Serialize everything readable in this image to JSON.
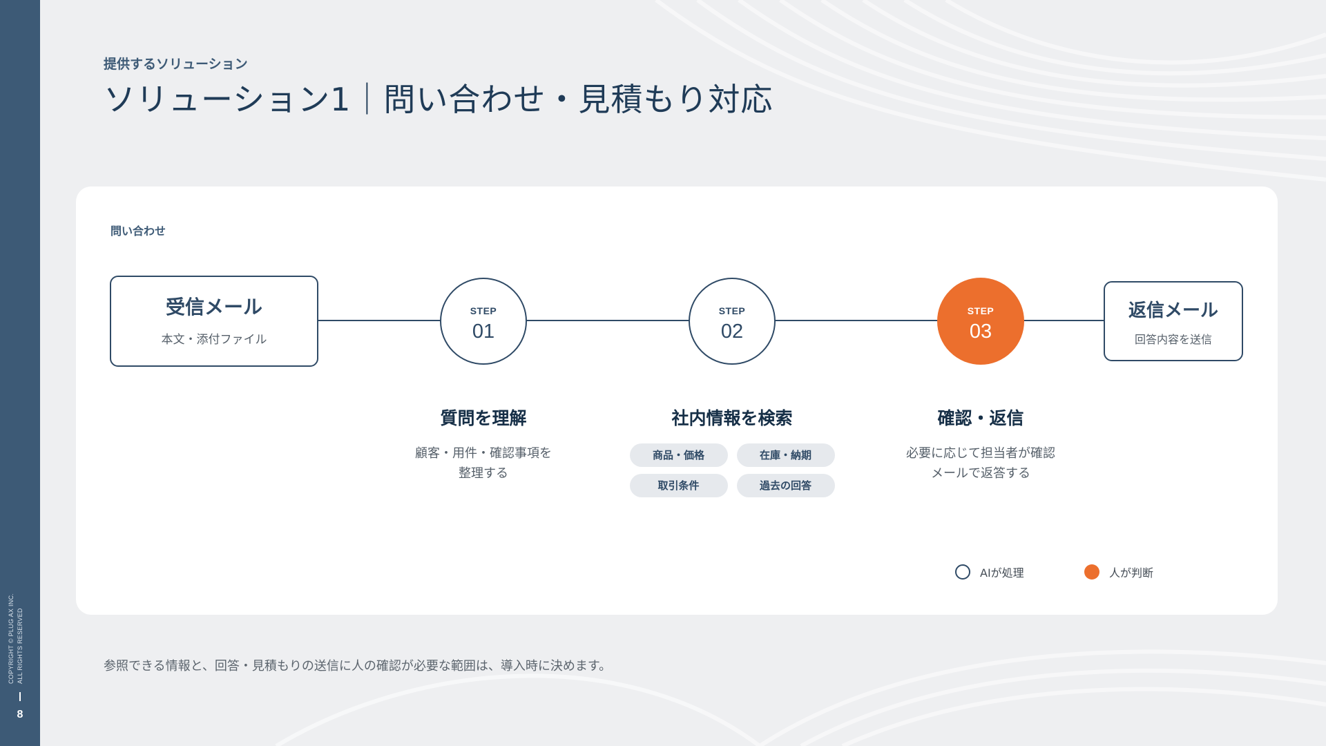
{
  "sidebar": {
    "copyright_line1": "COPYRIGHT © PLUG AX INC.",
    "copyright_line2": "ALL RIGHTS RESERVED",
    "page_number": "8"
  },
  "header": {
    "eyebrow": "提供するソリューション",
    "title": "ソリューション1｜問い合わせ・見積もり対応"
  },
  "card": {
    "label": "問い合わせ",
    "input_box": {
      "title": "受信メール",
      "subtitle": "本文・添付ファイル"
    },
    "output_box": {
      "title": "返信メール",
      "subtitle": "回答内容を送信"
    },
    "steps": [
      {
        "word": "STEP",
        "number": "01",
        "type": "ai",
        "title": "質問を理解",
        "desc_line1": "顧客・用件・確認事項を",
        "desc_line2": "整理する"
      },
      {
        "word": "STEP",
        "number": "02",
        "type": "ai",
        "title": "社内情報を検索",
        "tags": [
          "商品・価格",
          "在庫・納期",
          "取引条件",
          "過去の回答"
        ]
      },
      {
        "word": "STEP",
        "number": "03",
        "type": "human",
        "title": "確認・返信",
        "desc_line1": "必要に応じて担当者が確認",
        "desc_line2": "メールで返答する"
      }
    ],
    "legend": {
      "ai_label": "AIが処理",
      "human_label": "人が判断"
    }
  },
  "footnote": "参照できる情報と、回答・見積もりの送信に人の確認が必要な範囲は、導入時に決めます。",
  "colors": {
    "navy": "#2f4a66",
    "sidebar": "#3d5a76",
    "accent_orange": "#ec6f2d",
    "background": "#eeeff1"
  }
}
